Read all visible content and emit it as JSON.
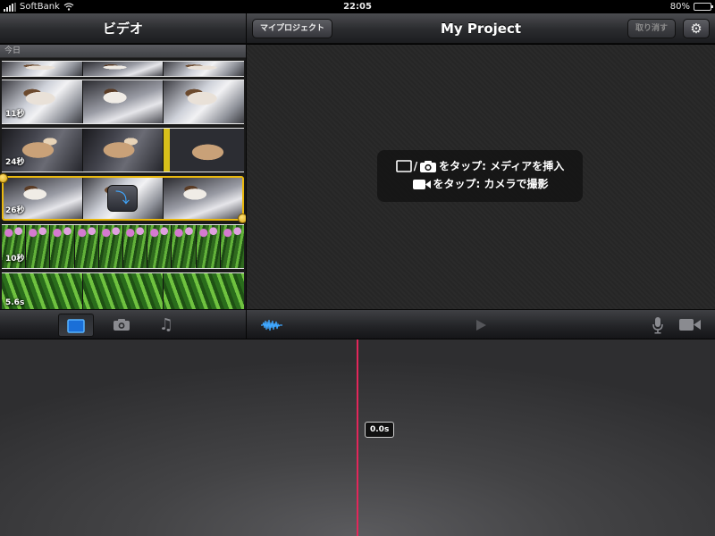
{
  "status_bar": {
    "carrier": "SoftBank",
    "time": "22:05",
    "battery": "80%",
    "battery_level": 0.8
  },
  "media_browser": {
    "title": "ビデオ",
    "section": "今日",
    "clips": [
      {
        "duration": "",
        "thumb": "cat"
      },
      {
        "duration": "11秒",
        "thumb": "cat"
      },
      {
        "duration": "24秒",
        "thumb": "cat2"
      },
      {
        "duration": "26秒",
        "thumb": "cat3",
        "selected": true
      },
      {
        "duration": "10秒",
        "thumb": "flower"
      },
      {
        "duration": "5.6s",
        "thumb": "greens"
      }
    ],
    "tabs": [
      "video-tab",
      "photo-tab",
      "music-tab"
    ],
    "active_tab": "video-tab"
  },
  "project": {
    "back_label": "マイプロジェクト",
    "title": "My Project",
    "undo_label": "取り消す",
    "settings_icon": "gear-icon"
  },
  "viewer": {
    "hint_line1": "をタップ: メディアを挿入",
    "hint_line2": "をタップ: カメラで撮影",
    "hint_separator": "/"
  },
  "toolbar": {
    "icons": [
      "waveform-icon",
      "play-icon",
      "microphone-icon",
      "video-camera-icon"
    ],
    "accent": "#3fa7ff"
  },
  "timeline": {
    "playhead_time": "0.0s",
    "playhead_color": "#e3265a"
  }
}
